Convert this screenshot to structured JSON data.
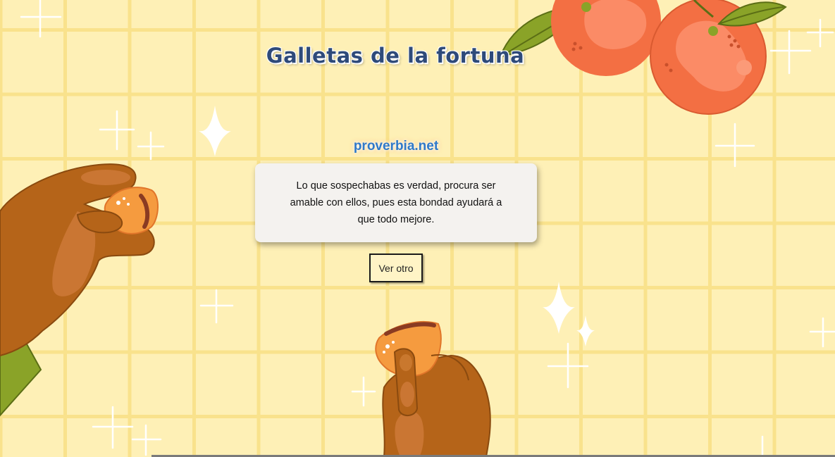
{
  "page": {
    "title": "Galletas de la fortuna",
    "source": "proverbia.net",
    "quote": "Lo que sospechabas es verdad, procura ser amable con ellos, pues esta bondad ayudará a que todo mejore.",
    "more_button_label": "Ver otro"
  },
  "colors": {
    "background": "#fef0b6",
    "grid_lines": "#f9e28c",
    "title": "#2e4a7a",
    "source_link": "#2f79c9",
    "card": "#f4f2ef",
    "orange": "#f36f43",
    "skin": "#b56419",
    "leaf": "#7f9b23"
  },
  "icons": {
    "oranges": "oranges-illustration",
    "left_hand": "hand-holding-cookie-left",
    "bottom_hand": "hand-holding-cookie-bottom",
    "sparkles": "sparkle-icons"
  }
}
